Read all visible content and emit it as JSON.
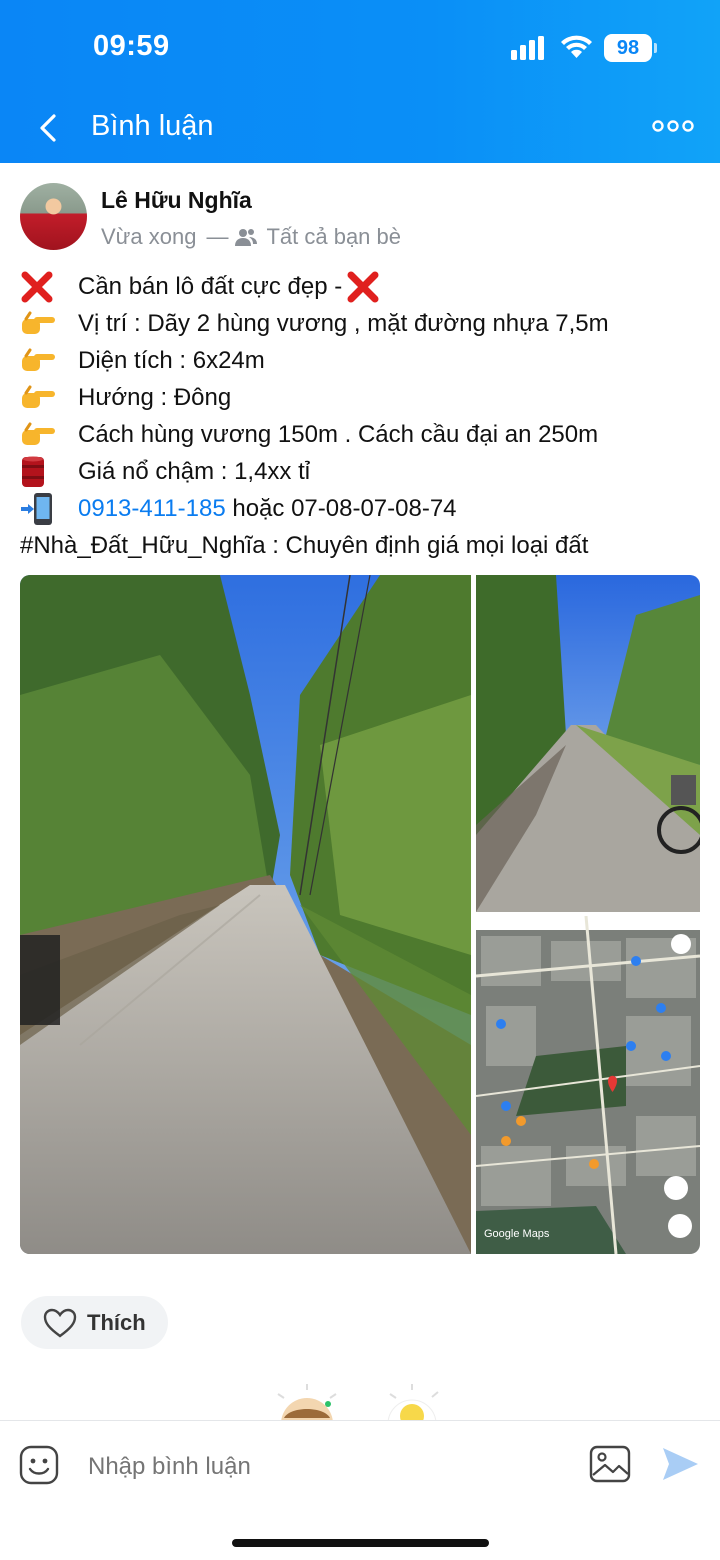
{
  "status_bar": {
    "time": "09:59",
    "battery": "98",
    "icons": [
      "signal-icon",
      "wifi-icon",
      "battery-icon"
    ]
  },
  "header": {
    "title": "Bình luận",
    "back_icon": "chevron-left-icon",
    "more_icon": "more-dots-icon"
  },
  "post": {
    "author": "Lê Hữu Nghĩa",
    "time": "Vừa xong",
    "separator": "—",
    "audience": "Tất cả bạn bè",
    "lines": [
      {
        "icon": "red-x-icon",
        "text": "Cần bán lô đất cực đẹp - ",
        "suffix_icon": "red-x-icon"
      },
      {
        "icon": "pointing-hand-icon",
        "text": "Vị trí : Dãy 2 hùng vương , mặt đường nhựa 7,5m"
      },
      {
        "icon": "pointing-hand-icon",
        "text": "Diện tích : 6x24m"
      },
      {
        "icon": "pointing-hand-icon",
        "text": "Hướng : Đông"
      },
      {
        "icon": "pointing-hand-icon",
        "text": "Cách hùng vương 150m . Cách cầu đại an 250m"
      },
      {
        "icon": "oil-drum-icon",
        "text": "Giá nổ chậm : 1,4xx tỉ"
      }
    ],
    "phone": "0913-411-185",
    "phone_rest": " hoặc 07-08-07-08-74",
    "phone_icon": "mobile-arrow-icon",
    "hashtag_line": "#Nhà_Đất_Hữu_Nghĩa : Chuyên định giá mọi loại đất",
    "map_watermark": "Google Maps"
  },
  "actions": {
    "like_label": "Thích"
  },
  "comment_bar": {
    "placeholder": "Nhập bình luận"
  },
  "colors": {
    "header_blue": "#0a86f6",
    "link_blue": "#0a7cf0",
    "muted": "#8a8f96"
  }
}
